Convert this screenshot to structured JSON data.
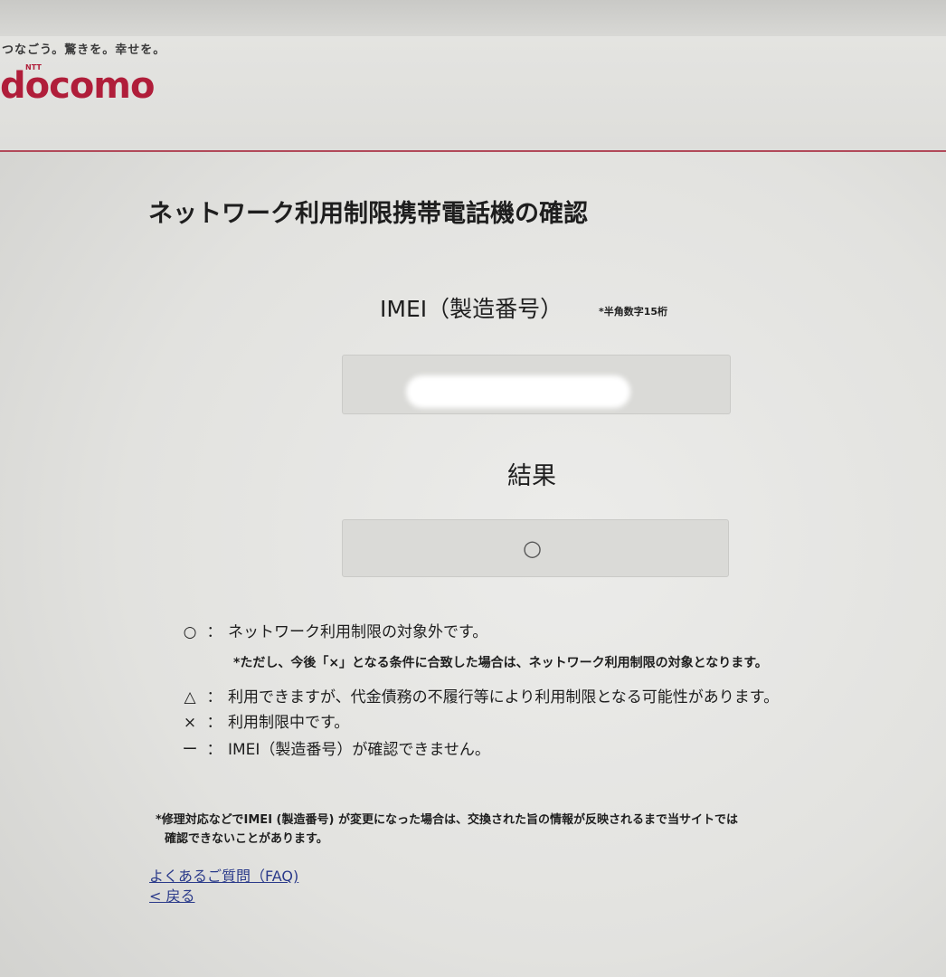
{
  "header": {
    "tagline": "つなごう。驚きを。幸せを。",
    "logo_sub": "NTT",
    "logo": "docomo",
    "brand_color": "#b01e3a"
  },
  "page": {
    "title": "ネットワーク利用制限携帯電話機の確認"
  },
  "imei": {
    "label": "IMEI（製造番号）",
    "note": "*半角数字15桁",
    "value": ""
  },
  "result": {
    "label": "結果",
    "value": "○"
  },
  "legend": [
    {
      "symbol": "○",
      "colon": "：",
      "text": "ネットワーク利用制限の対象外です。"
    },
    {
      "symbol": "△",
      "colon": "：",
      "text": "利用できますが、代金債務の不履行等により利用制限となる可能性があります。"
    },
    {
      "symbol": "×",
      "colon": "：",
      "text": "利用制限中です。"
    },
    {
      "symbol": "ー",
      "colon": "：",
      "text": "IMEI（製造番号）が確認できません。"
    }
  ],
  "legend_note": "*ただし、今後「×」となる条件に合致した場合は、ネットワーク利用制限の対象となります。",
  "footnote": {
    "line1": "*修理対応などでIMEI (製造番号) が変更になった場合は、交換された旨の情報が反映されるまで当サイトでは",
    "line2": "確認できないことがあります。"
  },
  "links": {
    "faq": "よくあるご質問（FAQ)",
    "back": "< 戻る"
  }
}
